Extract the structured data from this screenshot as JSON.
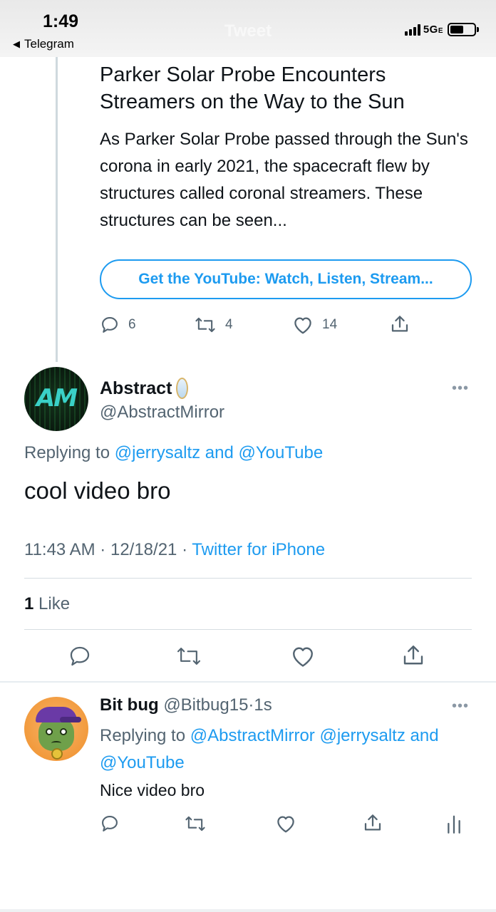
{
  "status_bar": {
    "time": "1:49",
    "back_app": "Telegram",
    "screen_title": "Tweet",
    "network": "5G",
    "network_suffix": "E"
  },
  "parent_tweet": {
    "card_title": "Parker Solar Probe Encounters Streamers on the Way to the Sun",
    "card_description": "As Parker Solar Probe passed through the Sun's corona in early 2021, the spacecraft flew by structures called coronal streamers. These structures can be seen...",
    "app_button_label": "Get the YouTube: Watch, Listen, Stream...",
    "reply_count": "6",
    "retweet_count": "4",
    "like_count": "14"
  },
  "focused_tweet": {
    "display_name": "Abstract",
    "handle": "@AbstractMirror",
    "avatar_text": "AM",
    "replying_prefix": "Replying to",
    "replying_to_1": "@jerrysaltz",
    "replying_and": "and",
    "replying_to_2": "@YouTube",
    "text": "cool video bro",
    "time": "11:43 AM",
    "separator": "·",
    "date": "12/18/21",
    "source": "Twitter for iPhone",
    "likes_count": "1",
    "likes_label": "Like"
  },
  "reply_tweet": {
    "display_name": "Bit bug",
    "handle": "@Bitbug15",
    "separator": "·",
    "age": "1s",
    "replying_prefix": "Replying to",
    "replying_to_1": "@AbstractMirror",
    "replying_to_2": "@jerrysaltz",
    "replying_and": "and",
    "replying_to_3": "@YouTube",
    "text": "Nice video bro"
  },
  "colors": {
    "link": "#1d9bf0",
    "secondary_text": "#536471",
    "primary_text": "#0f1419"
  },
  "icons": [
    "reply-icon",
    "retweet-icon",
    "like-icon",
    "share-icon",
    "analytics-icon",
    "more-icon",
    "battery-icon",
    "signal-icon"
  ]
}
